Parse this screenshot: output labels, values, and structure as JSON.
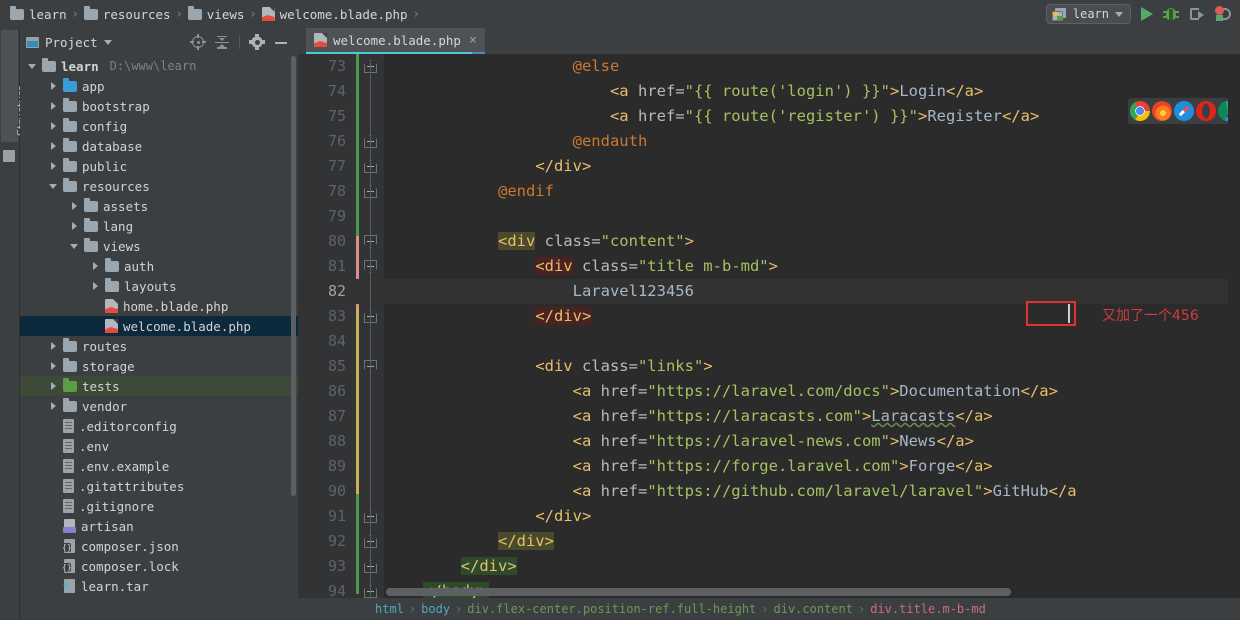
{
  "navbar": {
    "crumbs": [
      {
        "label": "learn",
        "icon": "folder-icon"
      },
      {
        "label": "resources",
        "icon": "folder-icon"
      },
      {
        "label": "views",
        "icon": "folder-icon"
      },
      {
        "label": "welcome.blade.php",
        "icon": "blade-file-icon"
      }
    ],
    "run_config": {
      "label": "learn",
      "icon": "run-config-icon",
      "caret": "chevron-down-icon"
    },
    "actions": [
      {
        "name": "run-button",
        "icon": "play-icon",
        "color": "#59a869"
      },
      {
        "name": "debug-button",
        "icon": "bug-icon",
        "color": "#5a9e46"
      },
      {
        "name": "run-with-coverage-button",
        "icon": "coverage-icon",
        "color": "#8f9396"
      },
      {
        "name": "stop-debug-button",
        "icon": "stop-debug-icon",
        "color": "#db5c5c"
      }
    ]
  },
  "tool_stripe": {
    "label": "Structure"
  },
  "project_panel": {
    "title": "Project",
    "tools": [
      {
        "name": "select-opened-file-button",
        "icon": "locate-icon"
      },
      {
        "name": "collapse-all-button",
        "icon": "collapse-all-icon"
      },
      {
        "name": "settings-button",
        "icon": "gear-icon"
      },
      {
        "name": "hide-button",
        "icon": "minimize-icon"
      }
    ],
    "tree": [
      {
        "label": "learn",
        "path": "D:\\www\\learn",
        "depth": 0,
        "icon": "folder-icon",
        "arrow": "down",
        "folder_color": "grey",
        "bold": true
      },
      {
        "label": "app",
        "depth": 1,
        "icon": "folder-icon",
        "arrow": "right",
        "folder_color": "blue"
      },
      {
        "label": "bootstrap",
        "depth": 1,
        "icon": "folder-icon",
        "arrow": "right",
        "folder_color": "grey"
      },
      {
        "label": "config",
        "depth": 1,
        "icon": "folder-icon",
        "arrow": "right",
        "folder_color": "grey"
      },
      {
        "label": "database",
        "depth": 1,
        "icon": "folder-icon",
        "arrow": "right",
        "folder_color": "grey"
      },
      {
        "label": "public",
        "depth": 1,
        "icon": "folder-icon",
        "arrow": "right",
        "folder_color": "grey"
      },
      {
        "label": "resources",
        "depth": 1,
        "icon": "folder-icon",
        "arrow": "down",
        "folder_color": "grey"
      },
      {
        "label": "assets",
        "depth": 2,
        "icon": "folder-icon",
        "arrow": "right",
        "folder_color": "grey"
      },
      {
        "label": "lang",
        "depth": 2,
        "icon": "folder-icon",
        "arrow": "right",
        "folder_color": "grey"
      },
      {
        "label": "views",
        "depth": 2,
        "icon": "folder-icon",
        "arrow": "down",
        "folder_color": "grey"
      },
      {
        "label": "auth",
        "depth": 3,
        "icon": "folder-icon",
        "arrow": "right",
        "folder_color": "grey"
      },
      {
        "label": "layouts",
        "depth": 3,
        "icon": "folder-icon",
        "arrow": "right",
        "folder_color": "grey"
      },
      {
        "label": "home.blade.php",
        "depth": 3,
        "icon": "blade-file-icon",
        "arrow": "none"
      },
      {
        "label": "welcome.blade.php",
        "depth": 3,
        "icon": "blade-file-icon",
        "arrow": "none",
        "selected": true
      },
      {
        "label": "routes",
        "depth": 1,
        "icon": "folder-icon",
        "arrow": "right",
        "folder_color": "grey"
      },
      {
        "label": "storage",
        "depth": 1,
        "icon": "folder-icon",
        "arrow": "right",
        "folder_color": "grey"
      },
      {
        "label": "tests",
        "depth": 1,
        "icon": "folder-icon",
        "arrow": "right",
        "folder_color": "green",
        "highlighted": true
      },
      {
        "label": "vendor",
        "depth": 1,
        "icon": "folder-icon",
        "arrow": "right",
        "folder_color": "grey"
      },
      {
        "label": ".editorconfig",
        "depth": 1,
        "icon": "text-file-icon",
        "arrow": "none"
      },
      {
        "label": ".env",
        "depth": 1,
        "icon": "text-file-icon",
        "arrow": "none"
      },
      {
        "label": ".env.example",
        "depth": 1,
        "icon": "text-file-icon",
        "arrow": "none"
      },
      {
        "label": ".gitattributes",
        "depth": 1,
        "icon": "text-file-icon",
        "arrow": "none"
      },
      {
        "label": ".gitignore",
        "depth": 1,
        "icon": "text-file-icon",
        "arrow": "none"
      },
      {
        "label": "artisan",
        "depth": 1,
        "icon": "php-file-icon",
        "arrow": "none"
      },
      {
        "label": "composer.json",
        "depth": 1,
        "icon": "json-file-icon",
        "arrow": "none"
      },
      {
        "label": "composer.lock",
        "depth": 1,
        "icon": "json-file-icon",
        "arrow": "none"
      },
      {
        "label": "learn.tar",
        "depth": 1,
        "icon": "archive-file-icon",
        "arrow": "none"
      }
    ]
  },
  "editor": {
    "tab": {
      "label": "welcome.blade.php",
      "icon": "blade-file-icon",
      "close": "×"
    },
    "annotation": "又加了一个456",
    "selection_text": "456",
    "browsers": [
      {
        "name": "chrome-icon"
      },
      {
        "name": "firefox-icon"
      },
      {
        "name": "safari-icon"
      },
      {
        "name": "opera-icon"
      },
      {
        "name": "edge-icon"
      }
    ],
    "lines": [
      {
        "n": "73",
        "indent": 0,
        "fold": "open",
        "segs": [
          {
            "t": "                    ",
            "c": "k-text"
          },
          {
            "t": "@else",
            "c": "k-blade"
          }
        ]
      },
      {
        "n": "74",
        "indent": 0,
        "fold": "none",
        "segs": [
          {
            "t": "                        ",
            "c": "k-text"
          },
          {
            "t": "<a",
            "c": "k-tag"
          },
          {
            "t": " href=",
            "c": "k-attr"
          },
          {
            "t": "\"{{ route(",
            "c": "k-str"
          },
          {
            "t": "'login'",
            "c": "k-str"
          },
          {
            "t": ") }}\"",
            "c": "k-str"
          },
          {
            "t": ">",
            "c": "k-tag"
          },
          {
            "t": "Login",
            "c": "k-text"
          },
          {
            "t": "</a>",
            "c": "k-tag"
          }
        ]
      },
      {
        "n": "75",
        "indent": 0,
        "fold": "none",
        "segs": [
          {
            "t": "                        ",
            "c": "k-text"
          },
          {
            "t": "<a",
            "c": "k-tag"
          },
          {
            "t": " href=",
            "c": "k-attr"
          },
          {
            "t": "\"{{ route(",
            "c": "k-str"
          },
          {
            "t": "'register'",
            "c": "k-str"
          },
          {
            "t": ") }}\"",
            "c": "k-str"
          },
          {
            "t": ">",
            "c": "k-tag"
          },
          {
            "t": "Register",
            "c": "k-text"
          },
          {
            "t": "</a>",
            "c": "k-tag"
          }
        ]
      },
      {
        "n": "76",
        "indent": 0,
        "fold": "open",
        "segs": [
          {
            "t": "                    ",
            "c": "k-text"
          },
          {
            "t": "@endauth",
            "c": "k-blade"
          }
        ]
      },
      {
        "n": "77",
        "indent": 0,
        "fold": "open",
        "segs": [
          {
            "t": "                ",
            "c": "k-text"
          },
          {
            "t": "</div>",
            "c": "k-tag"
          }
        ]
      },
      {
        "n": "78",
        "indent": 0,
        "fold": "open",
        "segs": [
          {
            "t": "            ",
            "c": "k-text"
          },
          {
            "t": "@endif",
            "c": "k-blade"
          }
        ]
      },
      {
        "n": "79",
        "indent": 0,
        "fold": "none",
        "segs": []
      },
      {
        "n": "80",
        "indent": 0,
        "fold": "close",
        "segs": [
          {
            "t": "            ",
            "c": "k-text"
          },
          {
            "t": "<div",
            "c": "k-tag hl-olive"
          },
          {
            "t": " class=",
            "c": "k-attr"
          },
          {
            "t": "\"content\"",
            "c": "k-str"
          },
          {
            "t": ">",
            "c": "k-tag"
          }
        ]
      },
      {
        "n": "81",
        "indent": 0,
        "fold": "close",
        "segs": [
          {
            "t": "                ",
            "c": "k-text"
          },
          {
            "t": "<div",
            "c": "k-tag hl-red"
          },
          {
            "t": " class=",
            "c": "k-attr"
          },
          {
            "t": "\"title m-b-md\"",
            "c": "k-str"
          },
          {
            "t": ">",
            "c": "k-tag"
          }
        ]
      },
      {
        "n": "82",
        "indent": 0,
        "fold": "none",
        "current": true,
        "segs": [
          {
            "t": "                    ",
            "c": "k-text"
          },
          {
            "t": "Laravel123",
            "c": "k-text"
          },
          {
            "t": "456",
            "c": "k-text sel"
          }
        ]
      },
      {
        "n": "83",
        "indent": 0,
        "fold": "open",
        "segs": [
          {
            "t": "                ",
            "c": "k-text"
          },
          {
            "t": "</div>",
            "c": "k-tag hl-red"
          }
        ]
      },
      {
        "n": "84",
        "indent": 0,
        "fold": "none",
        "segs": []
      },
      {
        "n": "85",
        "indent": 0,
        "fold": "close",
        "segs": [
          {
            "t": "                ",
            "c": "k-text"
          },
          {
            "t": "<div",
            "c": "k-tag"
          },
          {
            "t": " class=",
            "c": "k-attr"
          },
          {
            "t": "\"links\"",
            "c": "k-str"
          },
          {
            "t": ">",
            "c": "k-tag"
          }
        ]
      },
      {
        "n": "86",
        "indent": 0,
        "fold": "none",
        "segs": [
          {
            "t": "                    ",
            "c": "k-text"
          },
          {
            "t": "<a",
            "c": "k-tag"
          },
          {
            "t": " href=",
            "c": "k-attr"
          },
          {
            "t": "\"https://laravel.com/docs\"",
            "c": "k-str"
          },
          {
            "t": ">",
            "c": "k-tag"
          },
          {
            "t": "Documentation",
            "c": "k-text"
          },
          {
            "t": "</a>",
            "c": "k-tag"
          }
        ]
      },
      {
        "n": "87",
        "indent": 0,
        "fold": "none",
        "segs": [
          {
            "t": "                    ",
            "c": "k-text"
          },
          {
            "t": "<a",
            "c": "k-tag"
          },
          {
            "t": " href=",
            "c": "k-attr"
          },
          {
            "t": "\"https://laracasts.com\"",
            "c": "k-str"
          },
          {
            "t": ">",
            "c": "k-tag"
          },
          {
            "t": "Laracasts",
            "c": "k-text spell"
          },
          {
            "t": "</a>",
            "c": "k-tag"
          }
        ]
      },
      {
        "n": "88",
        "indent": 0,
        "fold": "none",
        "segs": [
          {
            "t": "                    ",
            "c": "k-text"
          },
          {
            "t": "<a",
            "c": "k-tag"
          },
          {
            "t": " href=",
            "c": "k-attr"
          },
          {
            "t": "\"https://laravel-news.com\"",
            "c": "k-str"
          },
          {
            "t": ">",
            "c": "k-tag"
          },
          {
            "t": "News",
            "c": "k-text"
          },
          {
            "t": "</a>",
            "c": "k-tag"
          }
        ]
      },
      {
        "n": "89",
        "indent": 0,
        "fold": "none",
        "segs": [
          {
            "t": "                    ",
            "c": "k-text"
          },
          {
            "t": "<a",
            "c": "k-tag"
          },
          {
            "t": " href=",
            "c": "k-attr"
          },
          {
            "t": "\"https://forge.laravel.com\"",
            "c": "k-str"
          },
          {
            "t": ">",
            "c": "k-tag"
          },
          {
            "t": "Forge",
            "c": "k-text"
          },
          {
            "t": "</a>",
            "c": "k-tag"
          }
        ]
      },
      {
        "n": "90",
        "indent": 0,
        "fold": "none",
        "segs": [
          {
            "t": "                    ",
            "c": "k-text"
          },
          {
            "t": "<a",
            "c": "k-tag"
          },
          {
            "t": " href=",
            "c": "k-attr"
          },
          {
            "t": "\"https://github.com/laravel/laravel\"",
            "c": "k-str"
          },
          {
            "t": ">",
            "c": "k-tag"
          },
          {
            "t": "GitHub",
            "c": "k-text"
          },
          {
            "t": "</a",
            "c": "k-tag"
          }
        ]
      },
      {
        "n": "91",
        "indent": 0,
        "fold": "open",
        "segs": [
          {
            "t": "                ",
            "c": "k-text"
          },
          {
            "t": "</div>",
            "c": "k-tag"
          }
        ]
      },
      {
        "n": "92",
        "indent": 0,
        "fold": "open",
        "segs": [
          {
            "t": "            ",
            "c": "k-text"
          },
          {
            "t": "</div>",
            "c": "k-tag hl-olive"
          }
        ]
      },
      {
        "n": "93",
        "indent": 0,
        "fold": "open",
        "segs": [
          {
            "t": "        ",
            "c": "k-text"
          },
          {
            "t": "</div>",
            "c": "k-tag hl-green"
          }
        ]
      },
      {
        "n": "94",
        "indent": 0,
        "fold": "open",
        "segs": [
          {
            "t": "    ",
            "c": "k-text"
          },
          {
            "t": "</body>",
            "c": "k-tag hl-green"
          }
        ]
      }
    ],
    "breadcrumbs": [
      {
        "label": "html",
        "color": "#4eaabf"
      },
      {
        "label": "body",
        "color": "#4eaabf"
      },
      {
        "label": "div.flex-center.position-ref.full-height",
        "color": "#6a9955"
      },
      {
        "label": "div.content",
        "color": "#6a9955"
      },
      {
        "label": "div.title.m-b-md",
        "color": "#c87070"
      }
    ],
    "breadcrumb_sep": "›"
  }
}
